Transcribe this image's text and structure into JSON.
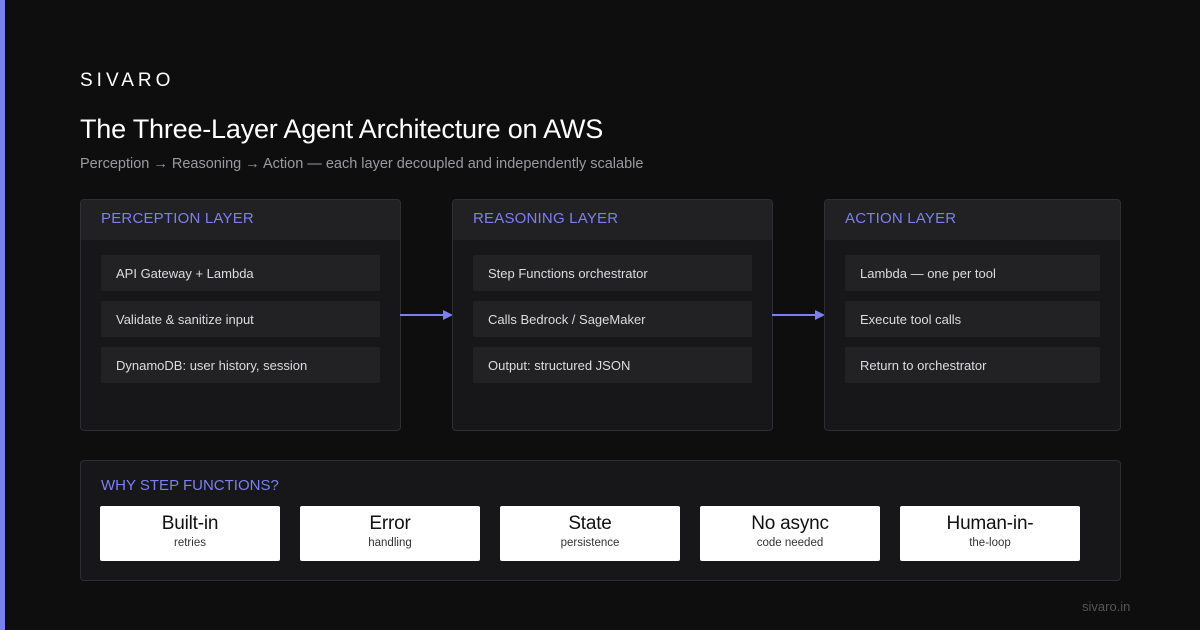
{
  "brand": "SIVARO",
  "title": "The Three-Layer Agent Architecture on AWS",
  "subtitle": "Perception → Reasoning → Action — each layer decoupled and independently scalable",
  "layers": [
    {
      "title": "PERCEPTION LAYER",
      "items": [
        "API Gateway + Lambda",
        "Validate & sanitize input",
        "DynamoDB: user history, session"
      ]
    },
    {
      "title": "REASONING LAYER",
      "items": [
        "Step Functions orchestrator",
        "Calls Bedrock / SageMaker",
        "Output: structured JSON"
      ]
    },
    {
      "title": "ACTION LAYER",
      "items": [
        "Lambda — one per tool",
        "Execute tool calls",
        "Return to orchestrator"
      ]
    }
  ],
  "why": {
    "title": "WHY STEP FUNCTIONS?",
    "cards": [
      {
        "main": "Built-in",
        "sub": "retries"
      },
      {
        "main": "Error",
        "sub": "handling"
      },
      {
        "main": "State",
        "sub": "persistence"
      },
      {
        "main": "No async",
        "sub": "code needed"
      },
      {
        "main": "Human-in-",
        "sub": "the-loop"
      }
    ]
  },
  "footer": "sivaro.in",
  "colors": {
    "background": "#0e0e0f",
    "accent": "#7b80f0",
    "panel": "#17171a",
    "panel_header": "#212124",
    "item": "#222225",
    "card": "#ffffff"
  }
}
